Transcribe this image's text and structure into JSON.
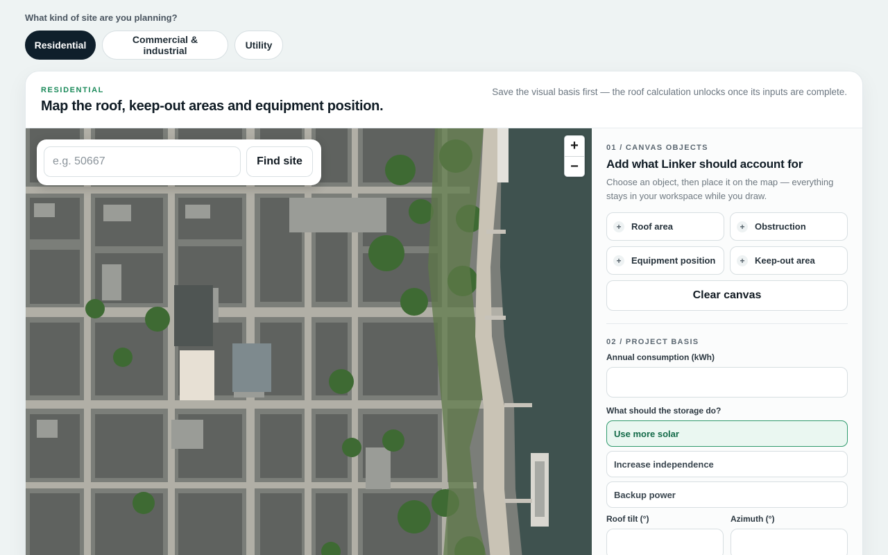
{
  "site_question": "What kind of site are you planning?",
  "site_types": [
    {
      "label": "Residential",
      "active": true
    },
    {
      "label": "Commercial & industrial",
      "active": false
    },
    {
      "label": "Utility",
      "active": false
    }
  ],
  "card": {
    "eyebrow": "RESIDENTIAL",
    "title": "Map the roof, keep-out areas and equipment position.",
    "note": "Save the visual basis first — the roof calculation unlocks once its inputs are complete."
  },
  "map": {
    "search_placeholder": "e.g. 50667",
    "find_label": "Find site",
    "zoom_in": "+",
    "zoom_out": "−"
  },
  "canvas_objects": {
    "label": "01 / CANVAS OBJECTS",
    "title": "Add what Linker should account for",
    "description": "Choose an object, then place it on the map — everything stays in your workspace while you draw.",
    "objects": [
      "Roof area",
      "Obstruction",
      "Equipment position",
      "Keep-out area"
    ],
    "clear_label": "Clear canvas"
  },
  "project_basis": {
    "label": "02 / PROJECT BASIS",
    "consumption_label": "Annual consumption (kWh)",
    "consumption_value": "",
    "storage_label": "What should the storage do?",
    "storage_options": [
      "Use more solar",
      "Increase independence",
      "Backup power"
    ],
    "storage_selected": "Use more solar",
    "tilt_label": "Roof tilt (°)",
    "azimuth_label": "Azimuth (°)"
  },
  "colors": {
    "accent": "#1b8a5a",
    "active_tab": "#0f1f2b",
    "selected_option_bg": "#eaf7f1"
  }
}
